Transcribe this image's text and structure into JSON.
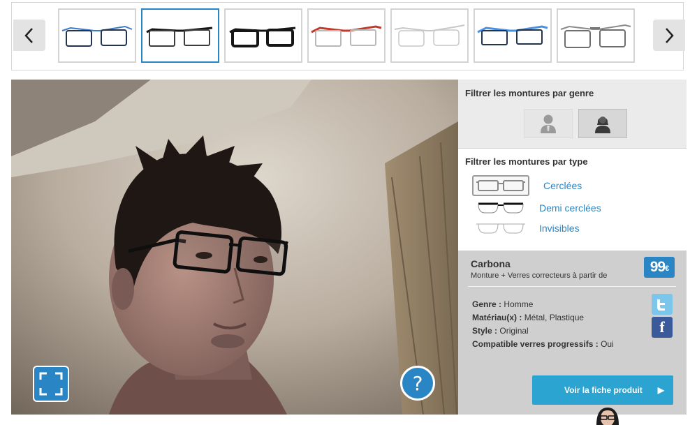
{
  "carousel": {
    "prev_icon": "chevron-left-icon",
    "next_icon": "chevron-right-icon",
    "thumbnails": [
      {
        "frame_color": "#23324f",
        "accent": "#3a78c8"
      },
      {
        "frame_color": "#3c3c3c",
        "accent": "#151515",
        "active": true
      },
      {
        "frame_color": "#151515",
        "accent": "#151515"
      },
      {
        "frame_color": "#b8b8b8",
        "accent": "#c0392b"
      },
      {
        "frame_color": "#c7c7c7",
        "accent": "#c7c7c7"
      },
      {
        "frame_color": "#23324f",
        "accent": "#4a90e2"
      },
      {
        "frame_color": "#6e6e6e",
        "accent": "#8a8a8a"
      }
    ]
  },
  "viewer": {
    "fullscreen_icon": "fullscreen-icon",
    "help_label": "?"
  },
  "filters": {
    "gender_title": "Filtrer les montures par genre",
    "gender_options": [
      "man-icon",
      "woman-icon"
    ],
    "type_title": "Filtrer les montures par type",
    "types": [
      {
        "label": "Cerclées",
        "selected": true
      },
      {
        "label": "Demi cerclées"
      },
      {
        "label": "Invisibles"
      }
    ]
  },
  "product": {
    "name": "Carbona",
    "subtitle": "Monture + Verres correcteurs à partir de",
    "price": "99",
    "currency": "€",
    "specs": [
      {
        "key": "Genre :",
        "value": "Homme"
      },
      {
        "key": "Matériau(x) :",
        "value": "Métal, Plastique"
      },
      {
        "key": "Style :",
        "value": "Original"
      },
      {
        "key": "Compatible verres progressifs :",
        "value": "Oui"
      }
    ],
    "social": [
      "twitter-icon",
      "facebook-icon"
    ],
    "facebook_glyph": "f",
    "cta_label": "Voir la fiche produit",
    "cta_icon": "play-triangle-icon"
  },
  "colors": {
    "accent": "#2a85c4",
    "cta": "#2ca4d2"
  }
}
